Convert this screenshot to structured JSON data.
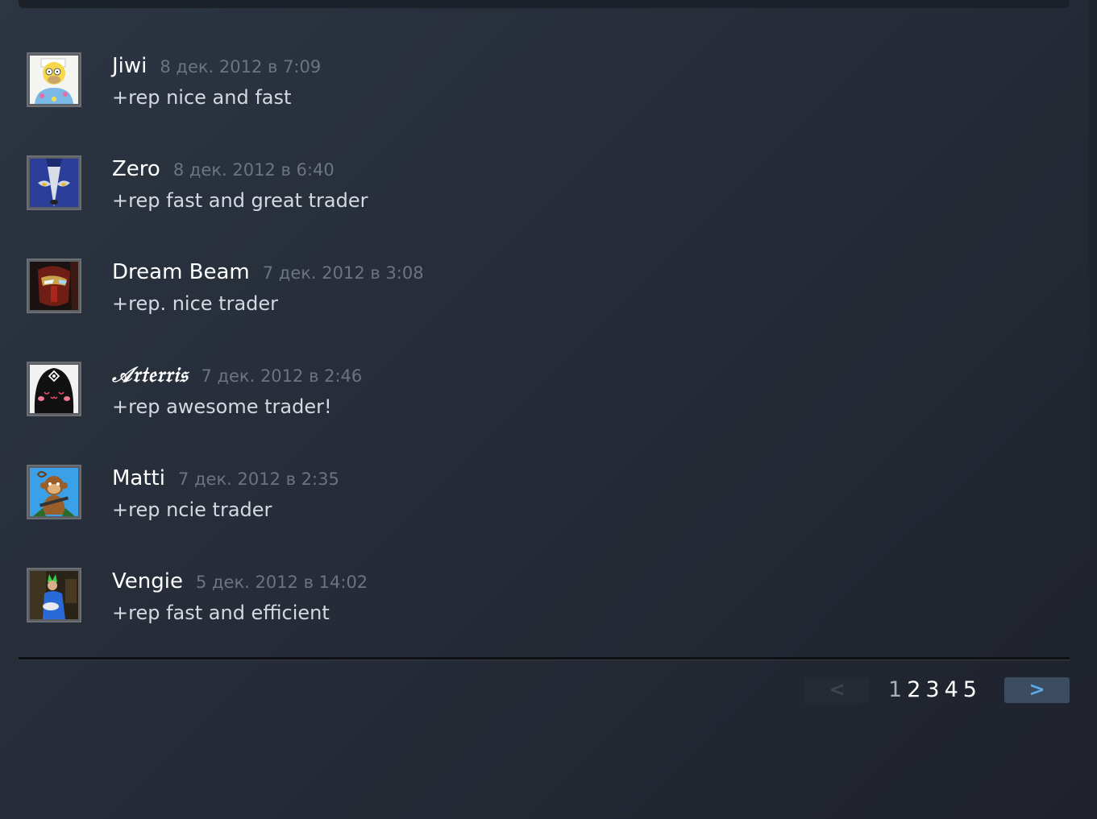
{
  "comments": [
    {
      "author": "Jiwi",
      "timestamp": "8 дек. 2012 в 7:09",
      "text": "+rep nice and fast",
      "avatar_icon": "homer-avatar"
    },
    {
      "author": "Zero",
      "timestamp": "8 дек. 2012 в 6:40",
      "text": "+rep fast and great trader",
      "avatar_icon": "wolf-avatar"
    },
    {
      "author": "Dream Beam",
      "timestamp": "7 дек. 2012 в 3:08",
      "text": "+rep. nice trader",
      "avatar_icon": "iron-man-avatar"
    },
    {
      "author": "𝒜𝔯𝔱𝔢𝔯𝔯𝔦𝔰",
      "timestamp": "7 дек. 2012 в 2:46",
      "text": "+rep awesome trader!",
      "avatar_icon": "hooded-face-avatar"
    },
    {
      "author": "Matti",
      "timestamp": "7 дек. 2012 в 2:35",
      "text": "+rep ncie trader",
      "avatar_icon": "monkey-avatar"
    },
    {
      "author": "Vengie",
      "timestamp": "5 дек. 2012 в 14:02",
      "text": "+rep fast and efficient",
      "avatar_icon": "gamer-photo-avatar"
    }
  ],
  "pagination": {
    "prev_label": "<",
    "next_label": ">",
    "pages": [
      "1",
      "2",
      "3",
      "4",
      "5"
    ],
    "current_page": "1"
  },
  "colors": {
    "author": "#ffffff",
    "timestamp": "#6b7480",
    "comment_text": "#d5d9df",
    "next_button_bg": "#3c4c60",
    "next_button_fg": "#5ba9e8"
  }
}
